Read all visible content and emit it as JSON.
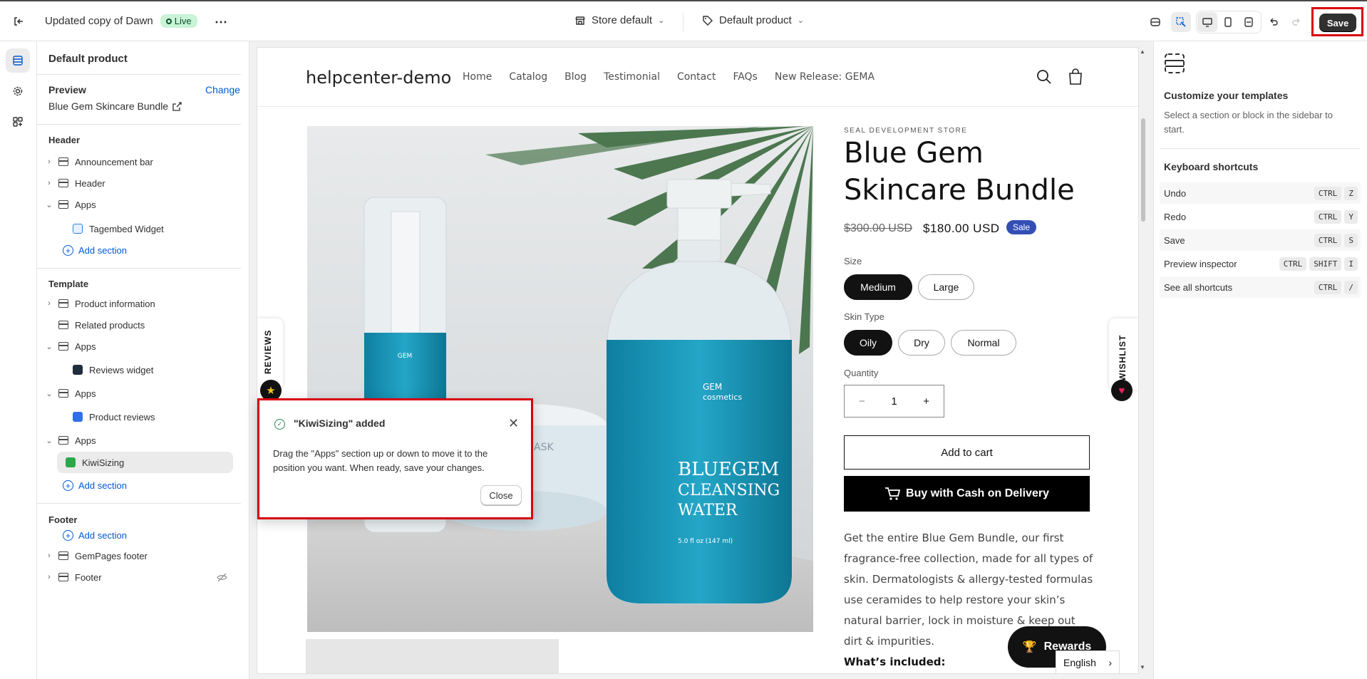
{
  "topbar": {
    "theme_name": "Updated copy of Dawn",
    "live_label": "Live",
    "store_selector": "Store default",
    "template_selector": "Default product",
    "save_label": "Save"
  },
  "sidebar": {
    "title": "Default product",
    "preview_label": "Preview",
    "change_label": "Change",
    "preview_product": "Blue Gem Skincare Bundle",
    "header_group": {
      "label": "Header",
      "items": [
        "Announcement bar",
        "Header",
        "Apps"
      ],
      "app_block": "Tagembed Widget",
      "add_section": "Add section"
    },
    "template_group": {
      "label": "Template",
      "items": [
        "Product information",
        "Related products",
        "Apps",
        "Apps",
        "Apps"
      ],
      "blocks": [
        "Reviews widget",
        "Product reviews",
        "KiwiSizing"
      ],
      "add_section": "Add section"
    },
    "footer_group": {
      "label": "Footer",
      "add_section": "Add section",
      "items": [
        "GemPages footer",
        "Footer"
      ]
    }
  },
  "store": {
    "logo": "helpcenter-demo",
    "nav": [
      "Home",
      "Catalog",
      "Blog",
      "Testimonial",
      "Contact",
      "FAQs",
      "New Release: GEMA"
    ],
    "vendor": "SEAL DEVELOPMENT STORE",
    "product_title": "Blue Gem Skincare Bundle",
    "old_price": "$300.00 USD",
    "new_price": "$180.00 USD",
    "sale_label": "Sale",
    "size_label": "Size",
    "sizes": [
      "Medium",
      "Large"
    ],
    "skin_label": "Skin Type",
    "skins": [
      "Oily",
      "Dry",
      "Normal"
    ],
    "qty_label": "Quantity",
    "qty_value": "1",
    "minus": "−",
    "plus": "+",
    "add_to_cart": "Add to cart",
    "buy_cod": "Buy with Cash on Delivery",
    "description": "Get the entire Blue Gem Bundle, our first fragrance-free collection, made for all types of skin. Dermatologists & allergy-tested formulas use ceramides to help restore your skin’s natural barrier, lock in moisture & keep out dirt & impurities.",
    "whats_included": "What’s included:",
    "reviews_tab": "REVIEWS",
    "wishlist_tab": "WISHLIST",
    "rewards": "Rewards",
    "language": "English",
    "bottle_brand": "GEM",
    "bottle_brand_sub": "cosmetics",
    "bottle_line1": "BLUEGEM",
    "bottle_line2": "CLEANSING",
    "bottle_line3": "WATER",
    "bottle_size": "5.0 fl oz (147 ml)",
    "jar_text": "ASK"
  },
  "toast": {
    "title": "\"KiwiSizing\" added",
    "body": "Drag the \"Apps\" section up or down to move it to the position you want. When ready, save your changes.",
    "close_label": "Close"
  },
  "right_panel": {
    "title": "Customize your templates",
    "subtitle": "Select a section or block in the sidebar to start.",
    "shortcuts_title": "Keyboard shortcuts",
    "shortcuts": [
      {
        "label": "Undo",
        "keys": [
          "CTRL",
          "Z"
        ]
      },
      {
        "label": "Redo",
        "keys": [
          "CTRL",
          "Y"
        ]
      },
      {
        "label": "Save",
        "keys": [
          "CTRL",
          "S"
        ]
      },
      {
        "label": "Preview inspector",
        "keys": [
          "CTRL",
          "SHIFT",
          "I"
        ]
      },
      {
        "label": "See all shortcuts",
        "keys": [
          "CTRL",
          "/"
        ]
      }
    ]
  },
  "colors": {
    "highlight_red": "#d8000c",
    "link_blue": "#005bd3",
    "sale_blue": "#334fb4",
    "live_green": "#c9f4d5"
  }
}
